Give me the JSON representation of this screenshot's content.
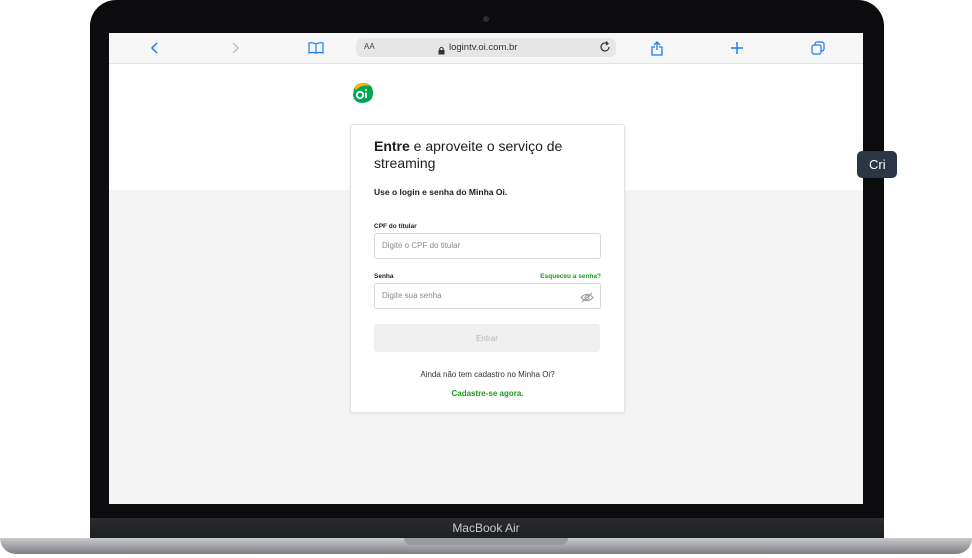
{
  "device": {
    "label": "MacBook Air"
  },
  "browser": {
    "url_text": "logintv.oi.com.br",
    "text_size_label": "AA",
    "icons": [
      "chevron-left-icon",
      "chevron-right-icon",
      "book-icon",
      "lock-icon",
      "reload-icon",
      "share-icon",
      "plus-icon",
      "tabs-icon"
    ]
  },
  "side_tab": {
    "label": "Cri"
  },
  "logo": {
    "text": "oi",
    "colors": {
      "top": "#ffb400",
      "bottom": "#00a651"
    }
  },
  "login_card": {
    "heading_bold": "Entre",
    "heading_rest": " e aproveite o serviço de streaming",
    "subtitle": "Use o login e senha do Minha Oi.",
    "cpf_label": "CPF do titular",
    "cpf_placeholder": "Digite o CPF do titular",
    "password_label": "Senha",
    "forgot_password": "Esqueceu a senha?",
    "password_placeholder": "Digite sua senha",
    "enter_button": "Entrar",
    "no_account_text": "Ainda não tem cadastro no Minha Oi?",
    "signup_link": "Cadastre-se agora."
  },
  "colors": {
    "accent_green": "#1a9c1a",
    "side_tab": "#2a3646"
  }
}
